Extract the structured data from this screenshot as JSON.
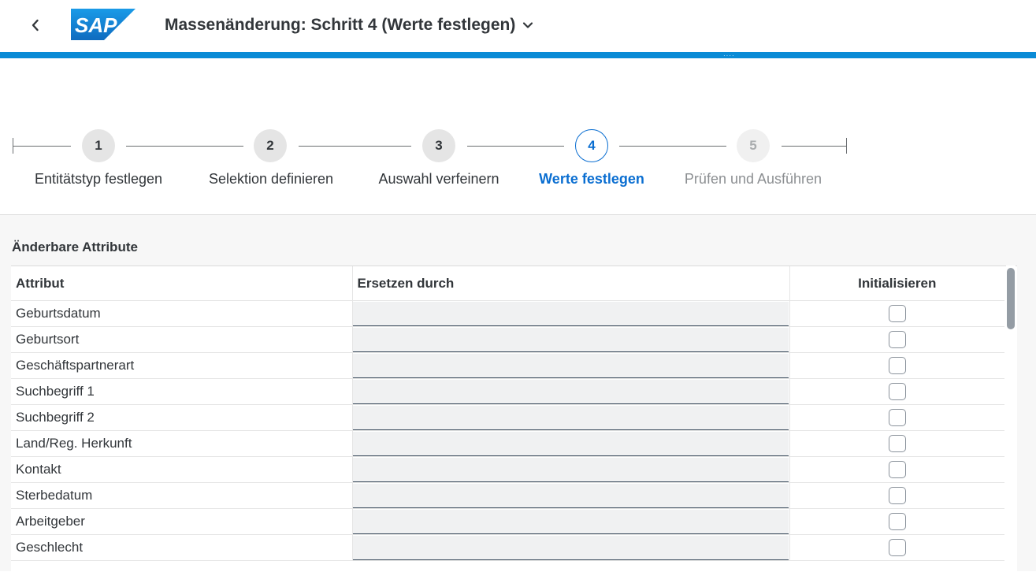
{
  "header": {
    "title": "Massenänderung: Schritt 4 (Werte festlegen)",
    "logo_text": "SAP",
    "back_icon": "chevron-left-icon",
    "title_menu_icon": "chevron-down-icon",
    "accent_color": "#0a8bd6"
  },
  "wizard": {
    "steps": [
      {
        "number": "1",
        "label": "Entitätstyp festlegen",
        "state": "completed"
      },
      {
        "number": "2",
        "label": "Selektion definieren",
        "state": "completed"
      },
      {
        "number": "3",
        "label": "Auswahl verfeinern",
        "state": "completed"
      },
      {
        "number": "4",
        "label": "Werte festlegen",
        "state": "active"
      },
      {
        "number": "5",
        "label": "Prüfen und Ausführen",
        "state": "disabled"
      }
    ],
    "active_color": "#0a6ed1"
  },
  "section": {
    "title": "Änderbare Attribute"
  },
  "table": {
    "columns": [
      "Attribut",
      "Ersetzen durch",
      "Initialisieren"
    ],
    "rows": [
      {
        "attribute": "Geburtsdatum",
        "value": "",
        "initialize": false
      },
      {
        "attribute": "Geburtsort",
        "value": "",
        "initialize": false
      },
      {
        "attribute": "Geschäftspartnerart",
        "value": "",
        "initialize": false
      },
      {
        "attribute": "Suchbegriff 1",
        "value": "",
        "initialize": false
      },
      {
        "attribute": "Suchbegriff 2",
        "value": "",
        "initialize": false
      },
      {
        "attribute": "Land/Reg. Herkunft",
        "value": "",
        "initialize": false
      },
      {
        "attribute": "Kontakt",
        "value": "",
        "initialize": false
      },
      {
        "attribute": "Sterbedatum",
        "value": "",
        "initialize": false
      },
      {
        "attribute": "Arbeitgeber",
        "value": "",
        "initialize": false
      },
      {
        "attribute": "Geschlecht",
        "value": "",
        "initialize": false
      }
    ]
  }
}
